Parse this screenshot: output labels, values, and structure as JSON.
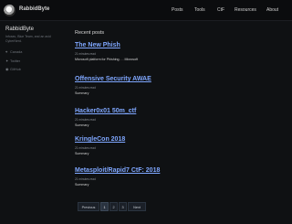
{
  "header": {
    "brand": "RabbidByte",
    "nav": [
      "Posts",
      "Tools",
      "CtF",
      "Resources",
      "About"
    ]
  },
  "sidebar": {
    "name": "RabbidByte",
    "bio": "Infosec, Blue Team, and an avid CyberNerd.",
    "links": [
      {
        "icon": "location-icon",
        "label": "Canada"
      },
      {
        "icon": "twitter-icon",
        "label": "Twitter"
      },
      {
        "icon": "github-icon",
        "label": "GitHub"
      }
    ]
  },
  "main": {
    "section_title": "Recent posts",
    "posts": [
      {
        "title": "The New Phish",
        "meta": "21 minutes read",
        "summary": "Microsoft platform for Phishing. . . Microsoft"
      },
      {
        "title": "Offensive Security AWAE",
        "meta": "21 minutes read",
        "summary": "Summary"
      },
      {
        "title": "Hacker0x01 50m_ctf",
        "meta": "21 minutes read",
        "summary": "Summary"
      },
      {
        "title": "KringleCon 2018",
        "meta": "21 minutes read",
        "summary": "Summary"
      },
      {
        "title": "Metasploit/Rapid7 CtF: 2018",
        "meta": "21 minutes read",
        "summary": "Summary"
      }
    ]
  },
  "pagination": {
    "previous": "Previous",
    "pages": [
      "1",
      "2",
      "3"
    ],
    "next": "Next",
    "current": "1"
  }
}
